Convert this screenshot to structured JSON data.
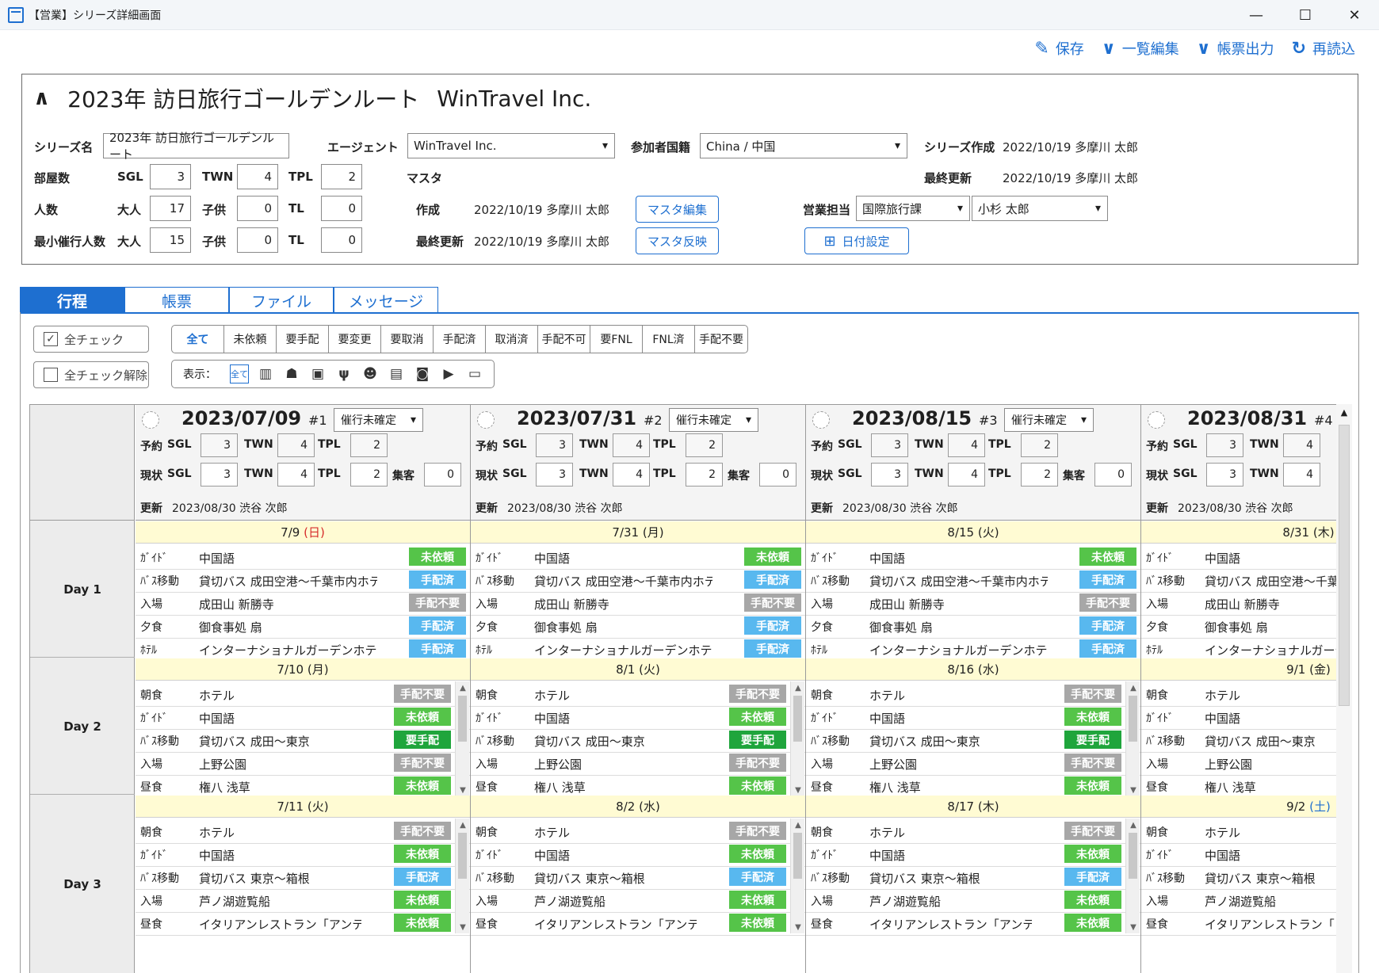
{
  "window": {
    "title": "【営業】シリーズ詳細画面",
    "buttons": {
      "minimize": "—",
      "maximize": "☐",
      "close": "✕"
    }
  },
  "toolbar": {
    "save": "保存",
    "bulk_edit": "一覧編集",
    "report_output": "帳票出力",
    "reload": "再読込"
  },
  "header": {
    "caret": "∧",
    "title": "2023年 訪日旅行ゴールデンルート",
    "agent_title": "WinTravel Inc.",
    "series_name_label": "シリーズ名",
    "series_name_value": "2023年 訪日旅行ゴールデンルート",
    "agent_label": "エージェント",
    "agent_value": "WinTravel Inc.",
    "nationality_label": "参加者国籍",
    "nationality_value": "China / 中国",
    "series_created_label": "シリーズ作成",
    "series_created_value": "2022/10/19 多摩川 太郎",
    "rooms_label": "部屋数",
    "sgl_label": "SGL",
    "twn_label": "TWN",
    "tpl_label": "TPL",
    "rooms_sgl": "3",
    "rooms_twn": "4",
    "rooms_tpl": "2",
    "master_label": "マスタ",
    "last_updated_label": "最終更新",
    "last_updated_value": "2022/10/19 多摩川 太郎",
    "people_label": "人数",
    "adult_label": "大人",
    "child_label": "子供",
    "tl_label": "TL",
    "people_adult": "17",
    "people_child": "0",
    "people_tl": "0",
    "created_label": "作成",
    "master_created_value": "2022/10/19 多摩川 太郎",
    "master_edit_button": "マスタ編集",
    "sales_label": "営業担当",
    "sales_dept": "国際旅行課",
    "sales_person": "小杉 太郎",
    "min_people_label": "最小催行人数",
    "min_adult": "15",
    "min_child": "0",
    "min_tl": "0",
    "master_updated_label": "最終更新",
    "master_updated_value": "2022/10/19 多摩川 太郎",
    "master_apply_button": "マスタ反映",
    "date_setting_button": "日付設定"
  },
  "tabs": [
    "行程",
    "帳票",
    "ファイル",
    "メッセージ"
  ],
  "controls": {
    "check_all": "全チェック",
    "uncheck_all": "全チェック解除",
    "filters": [
      "全て",
      "未依頼",
      "要手配",
      "要変更",
      "要取消",
      "手配済",
      "取消済",
      "手配不可",
      "要FNL",
      "FNL済",
      "手配不要"
    ],
    "display_label": "表示：",
    "display_all": "全て",
    "display_icons": [
      "building-icon",
      "hotel-bell-icon",
      "bus-icon",
      "restaurant-icon",
      "guide-icon",
      "luggage-icon",
      "camera-icon",
      "flag-icon",
      "message-icon"
    ]
  },
  "day_labels": [
    "Day 1",
    "Day 2",
    "Day 3"
  ],
  "col_labels": {
    "reservation": "予約",
    "current": "現状",
    "sgl": "SGL",
    "twn": "TWN",
    "tpl": "TPL",
    "gathering": "集客",
    "updated": "更新"
  },
  "columns": [
    {
      "date": "2023/07/09",
      "seq": "#1",
      "status": "催行未確定",
      "res": [
        "3",
        "4",
        "2"
      ],
      "cur": [
        "3",
        "4",
        "2"
      ],
      "gathering": "0",
      "updated": "2023/08/30 渋谷 次郎",
      "days": [
        {
          "head": "7/9",
          "wd": "(日)",
          "wdtype": "sun",
          "items": [
            [
              "ｶﾞｲﾄﾞ",
              "中国語",
              "未依頼",
              "green"
            ],
            [
              "ﾊﾞｽ移動",
              "貸切バス 成田空港～千葉市内ホテル",
              "手配済",
              "blue"
            ],
            [
              "入場",
              "成田山 新勝寺",
              "手配不要",
              "gray"
            ],
            [
              "夕食",
              "御食事処 扇",
              "手配済",
              "blue"
            ],
            [
              "ﾎﾃﾙ",
              "インターナショナルガーデンホテル成",
              "手配済",
              "blue"
            ]
          ]
        },
        {
          "head": "7/10",
          "wd": "(月)",
          "wdtype": "",
          "items": [
            [
              "朝食",
              "ホテル",
              "手配不要",
              "gray"
            ],
            [
              "ｶﾞｲﾄﾞ",
              "中国語",
              "未依頼",
              "green"
            ],
            [
              "ﾊﾞｽ移動",
              "貸切バス 成田～東京",
              "要手配",
              "dgreen"
            ],
            [
              "入場",
              "上野公園",
              "手配不要",
              "gray"
            ],
            [
              "昼食",
              "権八 浅草",
              "未依頼",
              "green"
            ]
          ]
        },
        {
          "head": "7/11",
          "wd": "(火)",
          "wdtype": "",
          "items": [
            [
              "朝食",
              "ホテル",
              "手配不要",
              "gray"
            ],
            [
              "ｶﾞｲﾄﾞ",
              "中国語",
              "未依頼",
              "green"
            ],
            [
              "ﾊﾞｽ移動",
              "貸切バス 東京～箱根",
              "手配済",
              "blue"
            ],
            [
              "入場",
              "芦ノ湖遊覧船",
              "未依頼",
              "green"
            ],
            [
              "昼食",
              "イタリアンレストラン「アンティノ",
              "未依頼",
              "green"
            ]
          ]
        }
      ]
    },
    {
      "date": "2023/07/31",
      "seq": "#2",
      "status": "催行未確定",
      "res": [
        "3",
        "4",
        "2"
      ],
      "cur": [
        "3",
        "4",
        "2"
      ],
      "gathering": "0",
      "updated": "2023/08/30 渋谷 次郎",
      "days": [
        {
          "head": "7/31",
          "wd": "(月)",
          "wdtype": "",
          "items": [
            [
              "ｶﾞｲﾄﾞ",
              "中国語",
              "未依頼",
              "green"
            ],
            [
              "ﾊﾞｽ移動",
              "貸切バス 成田空港～千葉市内ホテル",
              "手配済",
              "blue"
            ],
            [
              "入場",
              "成田山 新勝寺",
              "手配不要",
              "gray"
            ],
            [
              "夕食",
              "御食事処 扇",
              "手配済",
              "blue"
            ],
            [
              "ﾎﾃﾙ",
              "インターナショナルガーデンホテル成",
              "手配済",
              "blue"
            ]
          ]
        },
        {
          "head": "8/1",
          "wd": "(火)",
          "wdtype": "",
          "items": [
            [
              "朝食",
              "ホテル",
              "手配不要",
              "gray"
            ],
            [
              "ｶﾞｲﾄﾞ",
              "中国語",
              "未依頼",
              "green"
            ],
            [
              "ﾊﾞｽ移動",
              "貸切バス 成田～東京",
              "要手配",
              "dgreen"
            ],
            [
              "入場",
              "上野公園",
              "手配不要",
              "gray"
            ],
            [
              "昼食",
              "権八 浅草",
              "未依頼",
              "green"
            ]
          ]
        },
        {
          "head": "8/2",
          "wd": "(水)",
          "wdtype": "",
          "items": [
            [
              "朝食",
              "ホテル",
              "手配不要",
              "gray"
            ],
            [
              "ｶﾞｲﾄﾞ",
              "中国語",
              "未依頼",
              "green"
            ],
            [
              "ﾊﾞｽ移動",
              "貸切バス 東京～箱根",
              "手配済",
              "blue"
            ],
            [
              "入場",
              "芦ノ湖遊覧船",
              "未依頼",
              "green"
            ],
            [
              "昼食",
              "イタリアンレストラン「アンティノ",
              "未依頼",
              "green"
            ]
          ]
        }
      ]
    },
    {
      "date": "2023/08/15",
      "seq": "#3",
      "status": "催行未確定",
      "res": [
        "3",
        "4",
        "2"
      ],
      "cur": [
        "3",
        "4",
        "2"
      ],
      "gathering": "0",
      "updated": "2023/08/30 渋谷 次郎",
      "days": [
        {
          "head": "8/15",
          "wd": "(火)",
          "wdtype": "",
          "items": [
            [
              "ｶﾞｲﾄﾞ",
              "中国語",
              "未依頼",
              "green"
            ],
            [
              "ﾊﾞｽ移動",
              "貸切バス 成田空港～千葉市内ホテル",
              "手配済",
              "blue"
            ],
            [
              "入場",
              "成田山 新勝寺",
              "手配不要",
              "gray"
            ],
            [
              "夕食",
              "御食事処 扇",
              "手配済",
              "blue"
            ],
            [
              "ﾎﾃﾙ",
              "インターナショナルガーデンホテル成",
              "手配済",
              "blue"
            ]
          ]
        },
        {
          "head": "8/16",
          "wd": "(水)",
          "wdtype": "",
          "items": [
            [
              "朝食",
              "ホテル",
              "手配不要",
              "gray"
            ],
            [
              "ｶﾞｲﾄﾞ",
              "中国語",
              "未依頼",
              "green"
            ],
            [
              "ﾊﾞｽ移動",
              "貸切バス 成田～東京",
              "要手配",
              "dgreen"
            ],
            [
              "入場",
              "上野公園",
              "手配不要",
              "gray"
            ],
            [
              "昼食",
              "権八 浅草",
              "未依頼",
              "green"
            ]
          ]
        },
        {
          "head": "8/17",
          "wd": "(木)",
          "wdtype": "",
          "items": [
            [
              "朝食",
              "ホテル",
              "手配不要",
              "gray"
            ],
            [
              "ｶﾞｲﾄﾞ",
              "中国語",
              "未依頼",
              "green"
            ],
            [
              "ﾊﾞｽ移動",
              "貸切バス 東京～箱根",
              "手配済",
              "blue"
            ],
            [
              "入場",
              "芦ノ湖遊覧船",
              "未依頼",
              "green"
            ],
            [
              "昼食",
              "イタリアンレストラン「アンティノ",
              "未依頼",
              "green"
            ]
          ]
        }
      ]
    },
    {
      "date": "2023/08/31",
      "seq": "#4",
      "status": "",
      "res": [
        "3",
        "4",
        ""
      ],
      "cur": [
        "3",
        "4",
        ""
      ],
      "gathering": "",
      "updated": "2023/08/30 渋谷 次郎",
      "days": [
        {
          "head": "8/31",
          "wd": "(木)",
          "wdtype": "",
          "items": [
            [
              "ｶﾞｲﾄﾞ",
              "中国語",
              "",
              ""
            ],
            [
              "ﾊﾞｽ移動",
              "貸切バス 成田空港～千葉",
              "",
              ""
            ],
            [
              "入場",
              "成田山 新勝寺",
              "",
              ""
            ],
            [
              "夕食",
              "御食事処 扇",
              "",
              ""
            ],
            [
              "ﾎﾃﾙ",
              "インターナショナルガーデ",
              "",
              ""
            ]
          ]
        },
        {
          "head": "9/1",
          "wd": "(金)",
          "wdtype": "",
          "items": [
            [
              "朝食",
              "ホテル",
              "",
              ""
            ],
            [
              "ｶﾞｲﾄﾞ",
              "中国語",
              "",
              ""
            ],
            [
              "ﾊﾞｽ移動",
              "貸切バス 成田～東京",
              "",
              ""
            ],
            [
              "入場",
              "上野公園",
              "",
              ""
            ],
            [
              "昼食",
              "権八 浅草",
              "",
              ""
            ]
          ]
        },
        {
          "head": "9/2",
          "wd": "(土)",
          "wdtype": "sat",
          "items": [
            [
              "朝食",
              "ホテル",
              "",
              ""
            ],
            [
              "ｶﾞｲﾄﾞ",
              "中国語",
              "",
              ""
            ],
            [
              "ﾊﾞｽ移動",
              "貸切バス 東京～箱根",
              "",
              ""
            ],
            [
              "入場",
              "芦ノ湖遊覧船",
              "",
              ""
            ],
            [
              "昼食",
              "イタリアンレストラン「",
              "",
              ""
            ]
          ]
        }
      ]
    }
  ]
}
